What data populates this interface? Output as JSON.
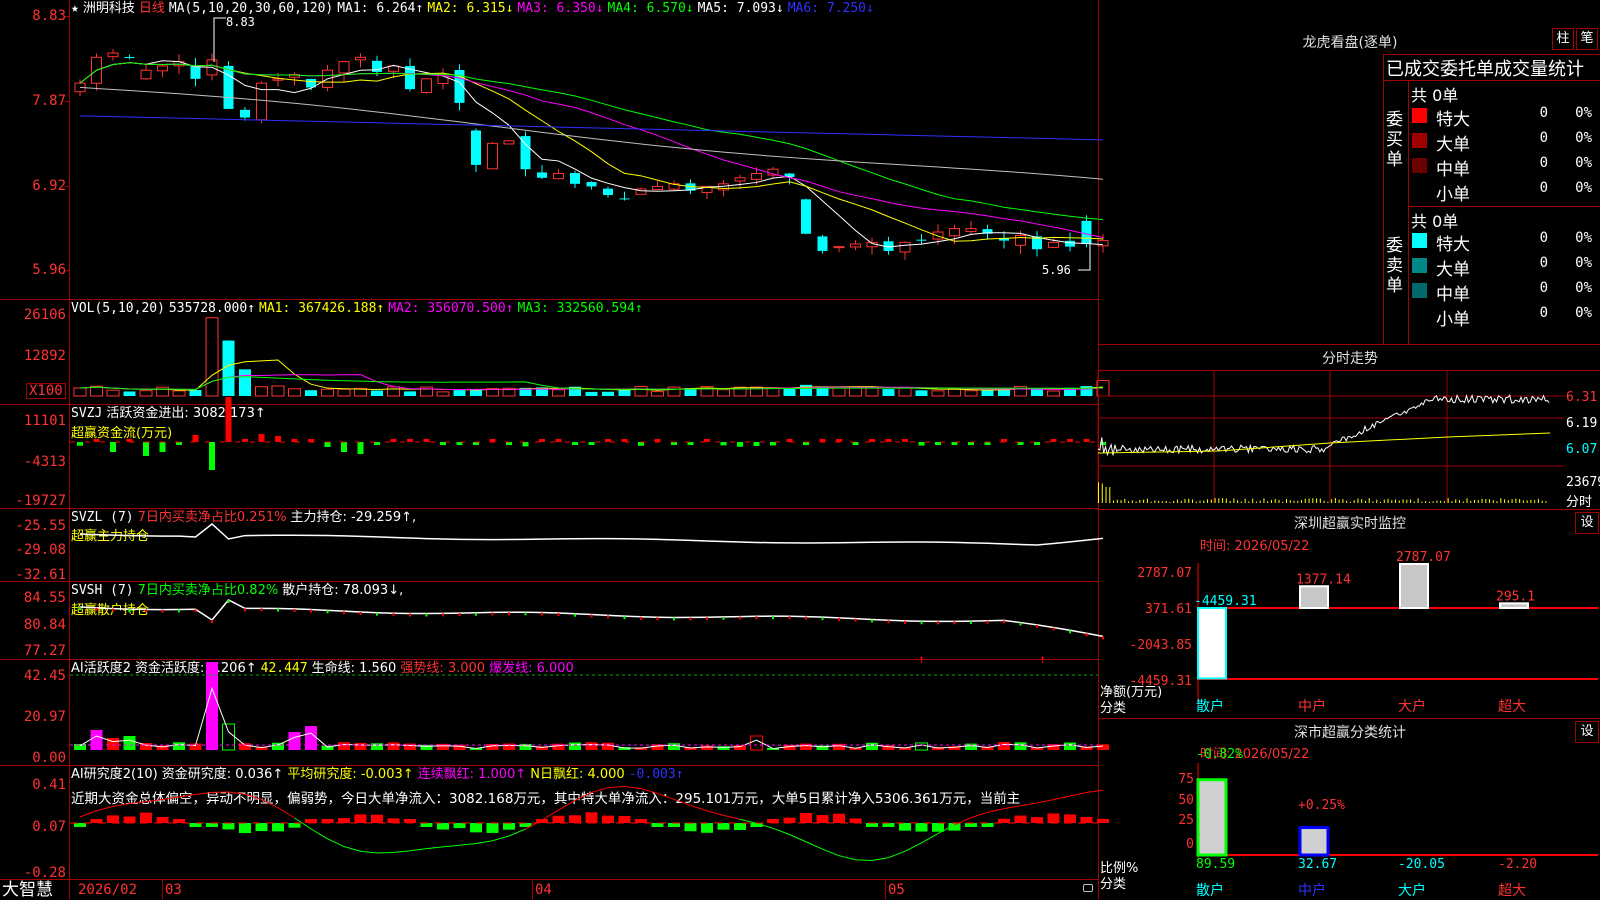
{
  "main_title": {
    "star": "★",
    "name": "洲明科技",
    "period": "日线",
    "ma_label": "MA(5,10,20,30,60,120)",
    "ma1": "MA1: 6.264↑",
    "ma2": "MA2: 6.315↓",
    "ma3": "MA3: 6.350↓",
    "ma4": "MA4: 6.570↓",
    "ma5": "MA5: 7.093↓",
    "ma6": "MA6: 7.250↓"
  },
  "price_axis": [
    "8.83",
    "7.87",
    "6.92",
    "5.96"
  ],
  "price_high_label": "8.83",
  "price_low_label": "5.96",
  "vol_title": {
    "label": "VOL(5,10,20)",
    "value": "535728.000↑",
    "ma1": "MA1: 367426.188↑",
    "ma2": "MA2: 356070.500↑",
    "ma3": "MA3: 332560.594↑"
  },
  "vol_axis": [
    "26106",
    "12892",
    "X100"
  ],
  "svzj_title": {
    "label": "SVZJ",
    "text": "活跃资金进出: 3082.173↑",
    "subtitle": "超赢资金流(万元)"
  },
  "svzj_axis": [
    "11101",
    "-4313",
    "-19727"
  ],
  "svzl_title": {
    "label": "SVZL (7)",
    "text1": "7日内买卖净占比0.251%",
    "text2": "主力持仓: -29.259↑,",
    "subtitle": "超赢主力持仓"
  },
  "svzl_axis": [
    "-25.55",
    "-29.08",
    "-32.61"
  ],
  "svsh_title": {
    "label": "SVSH (7)",
    "text1": "7日内买卖净占比0.82%",
    "text2": "散户持仓: 78.093↓,",
    "subtitle": "超赢散户持仓"
  },
  "svsh_axis": [
    "84.55",
    "80.84",
    "77.27"
  ],
  "ai_active_title": {
    "label": "AI活跃度2",
    "t1": "资金活跃度: 6.206↑",
    "t2": "42.447",
    "t3": "生命线: 1.560",
    "t4": "强势线: 3.000",
    "t5": "爆发线: 6.000"
  },
  "ai_active_axis": [
    "42.45",
    "20.97",
    "0.00"
  ],
  "ai_research_title": {
    "label": "AI研究度2(10)",
    "t1": "资金研究度: 0.036↑",
    "t2": "平均研究度: -0.003↑",
    "t3": "连续飘红: 1.000↑",
    "t4": "N日飘红: 4.000",
    "t5": "-0.003↑"
  },
  "ai_research_text": "近期大资金总体偏空，异动不明显，偏弱势，今日大单净流入：3082.168万元，其中特大单净流入：295.101万元，大单5日累计净入5306.361万元，当前主",
  "ai_research_axis": [
    "0.41",
    "0.07",
    "-0.28"
  ],
  "date_axis": {
    "brand": "大智慧",
    "labels": [
      "2026/02",
      "03",
      "04",
      "05"
    ]
  },
  "longhu": {
    "title": "龙虎看盘(逐单)",
    "btn_bar": "柱",
    "btn_pen": "笔",
    "header": "已成交委托单成交量统计",
    "buy_label": "委买单",
    "sell_label": "委卖单",
    "buy_total": "共 0单",
    "sell_total": "共 0单",
    "buy_rows": [
      {
        "name": "特大",
        "count": "0",
        "pct": "0%",
        "color": "#ff0000"
      },
      {
        "name": "大单",
        "count": "0",
        "pct": "0%",
        "color": "#a00000"
      },
      {
        "name": "中单",
        "count": "0",
        "pct": "0%",
        "color": "#6a0000"
      },
      {
        "name": "小单",
        "count": "0",
        "pct": "0%",
        "color": ""
      }
    ],
    "sell_rows": [
      {
        "name": "特大",
        "count": "0",
        "pct": "0%",
        "color": "#00ffff"
      },
      {
        "name": "大单",
        "count": "0",
        "pct": "0%",
        "color": "#008888"
      },
      {
        "name": "中单",
        "count": "0",
        "pct": "0%",
        "color": "#006a6a"
      },
      {
        "name": "小单",
        "count": "0",
        "pct": "0%",
        "color": ""
      }
    ]
  },
  "intraday": {
    "title": "分时走势",
    "axis": [
      "6.31",
      "6.19",
      "6.07",
      "23679",
      "分时"
    ]
  },
  "sz_monitor": {
    "title": "深圳超赢实时监控",
    "btn": "设",
    "time": "时间: 2026/05/22",
    "axis": [
      "2787.07",
      "371.61",
      "-2043.85",
      "-4459.31"
    ],
    "ylabel": "净额(万元)",
    "xlabel": "分类",
    "labels": [
      "-4459.31",
      "1377.14",
      "2787.07",
      "295.1"
    ],
    "categories": [
      "散户",
      "中户",
      "大户",
      "超大"
    ]
  },
  "sz_class": {
    "title": "深市超赢分类统计",
    "btn": "设",
    "time": "时间: 2026/05/22",
    "axis": [
      "75",
      "50",
      "25",
      "0"
    ],
    "top_labels": [
      "-0.82%",
      "+0.25%"
    ],
    "ylabel": "比例%",
    "xlabel": "分类",
    "values": [
      "89.59",
      "32.67",
      "-20.05",
      "-2.20"
    ],
    "categories": [
      "散户",
      "中户",
      "大户",
      "超大"
    ]
  },
  "colors": {
    "up": "#ff3232",
    "down": "#00ffff",
    "frame": "#a00000",
    "ma1": "#ffffff",
    "ma2": "#ffff00",
    "ma3": "#ff00ff",
    "ma4": "#00ff00",
    "ma5": "#c0c0c0",
    "ma6": "#3030ff"
  }
}
